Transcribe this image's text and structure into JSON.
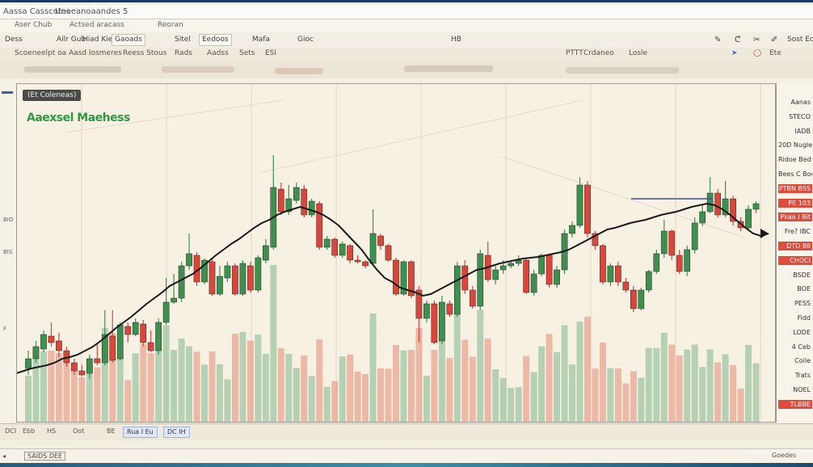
{
  "window": {
    "title_left": "Aassa Casscotes",
    "title_mid": "Uneeanoaandes 5"
  },
  "menu": [
    "Aser Chub",
    "Actsed aracass",
    "Reoran"
  ],
  "toolbar": {
    "left": [
      "Dess",
      "",
      "Ailr Gub",
      "Hiad Kiew Ed",
      "Gaoads",
      "Sitel",
      "Eedoos",
      "Mafa",
      "Gioc",
      "HB"
    ],
    "right": [
      "Sost Ede"
    ]
  },
  "tabs": {
    "left": [
      "Scoeneelpt oa",
      "Aasd Iosmeres",
      "Reess Stous",
      "Rads",
      "Aadss",
      "Sets",
      "ESI"
    ],
    "right_label": "Crdaneo",
    "right_extra": "Losle",
    "right_small": "Ete",
    "pttt": "PTTT"
  },
  "chart": {
    "legend_label": "(Et Coleneas)",
    "title": "Aaexsel Maehess",
    "colors": {
      "up": "#3f8f4f",
      "down": "#d9473a",
      "line": "#1a1a1a",
      "accent_blue": "#3c4ea3"
    }
  },
  "price_panel": [
    {
      "label": "Aanas",
      "style": "plain"
    },
    {
      "label": "STECO",
      "style": "plain"
    },
    {
      "label": "IADB",
      "style": "plain"
    },
    {
      "label": "20D Nugle",
      "style": "plain"
    },
    {
      "label": "Ridoe Bed",
      "style": "plain"
    },
    {
      "label": "Bees C Boe",
      "style": "plain"
    },
    {
      "label": "PTBN BSS",
      "style": "red"
    },
    {
      "label": "PE 103",
      "style": "red"
    },
    {
      "label": "Pkaa I Bit",
      "style": "red"
    },
    {
      "label": "Fre? IBC",
      "style": "plain"
    },
    {
      "label": "DTD 88",
      "style": "red"
    },
    {
      "label": "CHOCI",
      "style": "red"
    },
    {
      "label": "BSDE",
      "style": "plain"
    },
    {
      "label": "BOE",
      "style": "plain"
    },
    {
      "label": "PESS",
      "style": "plain"
    },
    {
      "label": "Fidd",
      "style": "plain"
    },
    {
      "label": "LODE",
      "style": "plain"
    },
    {
      "label": "4 Ceb",
      "style": "plain"
    },
    {
      "label": "Coile",
      "style": "plain"
    },
    {
      "label": "Trats",
      "style": "plain"
    },
    {
      "label": "NOEL",
      "style": "plain"
    },
    {
      "label": "TLBBE",
      "style": "red"
    }
  ],
  "left_strip": [
    "BIO",
    "BIS",
    "F"
  ],
  "bottom": {
    "left_label": "DCI",
    "items": [
      "Ebb",
      "HS",
      "Oot",
      "BE"
    ],
    "tab1": "Rua I Eu",
    "tab2": "DC IH"
  },
  "footer": {
    "left": "SAIDS DEE",
    "right": "Goedes"
  },
  "chart_data": {
    "type": "candlestick",
    "candles": [
      {
        "o": 452,
        "c": 440,
        "h": 460,
        "l": 430
      },
      {
        "o": 440,
        "c": 425,
        "h": 445,
        "l": 418
      },
      {
        "o": 428,
        "c": 410,
        "h": 432,
        "l": 405
      },
      {
        "o": 412,
        "c": 420,
        "h": 425,
        "l": 395
      },
      {
        "o": 418,
        "c": 430,
        "h": 438,
        "l": 408
      },
      {
        "o": 430,
        "c": 445,
        "h": 450,
        "l": 425
      },
      {
        "o": 445,
        "c": 455,
        "h": 460,
        "l": 440
      },
      {
        "o": 455,
        "c": 460,
        "h": 462,
        "l": 448
      },
      {
        "o": 458,
        "c": 440,
        "h": 465,
        "l": 435
      },
      {
        "o": 440,
        "c": 445,
        "h": 448,
        "l": 420
      },
      {
        "o": 445,
        "c": 410,
        "h": 448,
        "l": 380
      },
      {
        "o": 412,
        "c": 442,
        "h": 445,
        "l": 380
      },
      {
        "o": 440,
        "c": 398,
        "h": 442,
        "l": 395
      },
      {
        "o": 400,
        "c": 410,
        "h": 420,
        "l": 395
      },
      {
        "o": 410,
        "c": 395,
        "h": 412,
        "l": 390
      },
      {
        "o": 397,
        "c": 420,
        "h": 425,
        "l": 392
      },
      {
        "o": 420,
        "c": 430,
        "h": 432,
        "l": 405
      },
      {
        "o": 430,
        "c": 395,
        "h": 435,
        "l": 390
      },
      {
        "o": 395,
        "c": 370,
        "h": 398,
        "l": 340
      },
      {
        "o": 370,
        "c": 365,
        "h": 372,
        "l": 335
      },
      {
        "o": 365,
        "c": 325,
        "h": 370,
        "l": 320
      },
      {
        "o": 325,
        "c": 310,
        "h": 330,
        "l": 285
      },
      {
        "o": 312,
        "c": 345,
        "h": 350,
        "l": 308
      },
      {
        "o": 345,
        "c": 318,
        "h": 348,
        "l": 316
      },
      {
        "o": 320,
        "c": 360,
        "h": 362,
        "l": 315
      },
      {
        "o": 360,
        "c": 338,
        "h": 362,
        "l": 325
      },
      {
        "o": 340,
        "c": 325,
        "h": 345,
        "l": 320
      },
      {
        "o": 325,
        "c": 360,
        "h": 362,
        "l": 322
      },
      {
        "o": 360,
        "c": 322,
        "h": 362,
        "l": 318
      },
      {
        "o": 325,
        "c": 355,
        "h": 358,
        "l": 320
      },
      {
        "o": 355,
        "c": 315,
        "h": 358,
        "l": 312
      },
      {
        "o": 318,
        "c": 300,
        "h": 322,
        "l": 292
      },
      {
        "o": 302,
        "c": 228,
        "h": 305,
        "l": 188
      },
      {
        "o": 230,
        "c": 258,
        "h": 262,
        "l": 222
      },
      {
        "o": 258,
        "c": 242,
        "h": 262,
        "l": 225
      },
      {
        "o": 244,
        "c": 228,
        "h": 248,
        "l": 222
      },
      {
        "o": 230,
        "c": 262,
        "h": 265,
        "l": 225
      },
      {
        "o": 262,
        "c": 245,
        "h": 265,
        "l": 242
      },
      {
        "o": 248,
        "c": 302,
        "h": 305,
        "l": 245
      },
      {
        "o": 302,
        "c": 292,
        "h": 305,
        "l": 288
      },
      {
        "o": 292,
        "c": 312,
        "h": 315,
        "l": 290
      },
      {
        "o": 312,
        "c": 298,
        "h": 315,
        "l": 295
      },
      {
        "o": 300,
        "c": 318,
        "h": 322,
        "l": 298
      },
      {
        "o": 318,
        "c": 320,
        "h": 322,
        "l": 312
      },
      {
        "o": 320,
        "c": 325,
        "h": 328,
        "l": 318
      },
      {
        "o": 322,
        "c": 285,
        "h": 325,
        "l": 255
      },
      {
        "o": 288,
        "c": 300,
        "h": 305,
        "l": 285
      },
      {
        "o": 300,
        "c": 318,
        "h": 320,
        "l": 298
      },
      {
        "o": 318,
        "c": 360,
        "h": 362,
        "l": 315
      },
      {
        "o": 360,
        "c": 320,
        "h": 362,
        "l": 318
      },
      {
        "o": 320,
        "c": 362,
        "h": 365,
        "l": 318
      },
      {
        "o": 355,
        "c": 390,
        "h": 420,
        "l": 350
      },
      {
        "o": 390,
        "c": 372,
        "h": 395,
        "l": 368
      },
      {
        "o": 372,
        "c": 420,
        "h": 422,
        "l": 368
      },
      {
        "o": 418,
        "c": 370,
        "h": 422,
        "l": 362
      },
      {
        "o": 372,
        "c": 385,
        "h": 388,
        "l": 368
      },
      {
        "o": 385,
        "c": 325,
        "h": 388,
        "l": 320
      },
      {
        "o": 325,
        "c": 355,
        "h": 360,
        "l": 318
      },
      {
        "o": 355,
        "c": 375,
        "h": 378,
        "l": 350
      },
      {
        "o": 375,
        "c": 310,
        "h": 380,
        "l": 305
      },
      {
        "o": 312,
        "c": 342,
        "h": 345,
        "l": 295
      },
      {
        "o": 342,
        "c": 330,
        "h": 348,
        "l": 325
      },
      {
        "o": 330,
        "c": 325,
        "h": 335,
        "l": 318
      },
      {
        "o": 325,
        "c": 322,
        "h": 328,
        "l": 318
      },
      {
        "o": 322,
        "c": 318,
        "h": 325,
        "l": 312
      },
      {
        "o": 318,
        "c": 358,
        "h": 360,
        "l": 315
      },
      {
        "o": 358,
        "c": 335,
        "h": 362,
        "l": 330
      },
      {
        "o": 335,
        "c": 312,
        "h": 338,
        "l": 310
      },
      {
        "o": 312,
        "c": 348,
        "h": 352,
        "l": 310
      },
      {
        "o": 348,
        "c": 330,
        "h": 352,
        "l": 325
      },
      {
        "o": 330,
        "c": 285,
        "h": 335,
        "l": 280
      },
      {
        "o": 285,
        "c": 275,
        "h": 290,
        "l": 270
      },
      {
        "o": 275,
        "c": 225,
        "h": 278,
        "l": 215
      },
      {
        "o": 225,
        "c": 285,
        "h": 290,
        "l": 220
      },
      {
        "o": 285,
        "c": 300,
        "h": 305,
        "l": 282
      },
      {
        "o": 300,
        "c": 345,
        "h": 348,
        "l": 298
      },
      {
        "o": 345,
        "c": 325,
        "h": 350,
        "l": 322
      },
      {
        "o": 325,
        "c": 345,
        "h": 350,
        "l": 320
      },
      {
        "o": 345,
        "c": 355,
        "h": 358,
        "l": 340
      },
      {
        "o": 355,
        "c": 378,
        "h": 382,
        "l": 350
      },
      {
        "o": 378,
        "c": 355,
        "h": 380,
        "l": 352
      },
      {
        "o": 355,
        "c": 332,
        "h": 358,
        "l": 330
      },
      {
        "o": 332,
        "c": 310,
        "h": 335,
        "l": 305
      },
      {
        "o": 310,
        "c": 282,
        "h": 315,
        "l": 268
      },
      {
        "o": 282,
        "c": 312,
        "h": 318,
        "l": 280
      },
      {
        "o": 312,
        "c": 332,
        "h": 335,
        "l": 305
      },
      {
        "o": 332,
        "c": 305,
        "h": 338,
        "l": 300
      },
      {
        "o": 305,
        "c": 272,
        "h": 310,
        "l": 265
      },
      {
        "o": 272,
        "c": 258,
        "h": 276,
        "l": 250
      },
      {
        "o": 258,
        "c": 235,
        "h": 260,
        "l": 215
      },
      {
        "o": 235,
        "c": 262,
        "h": 265,
        "l": 230
      },
      {
        "o": 262,
        "c": 242,
        "h": 265,
        "l": 220
      },
      {
        "o": 242,
        "c": 270,
        "h": 275,
        "l": 238
      },
      {
        "o": 270,
        "c": 278,
        "h": 282,
        "l": 265
      },
      {
        "o": 278,
        "c": 255,
        "h": 280,
        "l": 250
      },
      {
        "o": 255,
        "c": 248,
        "h": 260,
        "l": 245
      }
    ],
    "line": [
      465,
      462,
      458,
      455,
      452,
      450,
      448,
      445,
      440,
      438,
      435,
      430,
      425,
      418,
      410,
      402,
      395,
      388,
      380,
      372,
      365,
      358,
      350,
      345,
      340,
      335,
      328,
      320,
      312,
      305,
      298,
      292,
      285,
      278,
      272,
      268,
      262,
      258,
      255,
      252,
      255,
      258,
      262,
      268,
      275,
      285,
      295,
      305,
      318,
      330,
      340,
      345,
      352,
      355,
      358,
      362,
      360,
      355,
      350,
      345,
      340,
      335,
      330,
      328,
      325,
      322,
      320,
      318,
      316,
      315,
      314,
      312,
      310,
      308,
      305,
      300,
      295,
      290,
      285,
      280,
      278,
      275,
      272,
      270,
      268,
      265,
      262,
      260,
      258,
      255,
      252,
      250,
      248,
      250,
      255,
      262,
      270,
      278,
      285,
      288,
      285
    ]
  }
}
